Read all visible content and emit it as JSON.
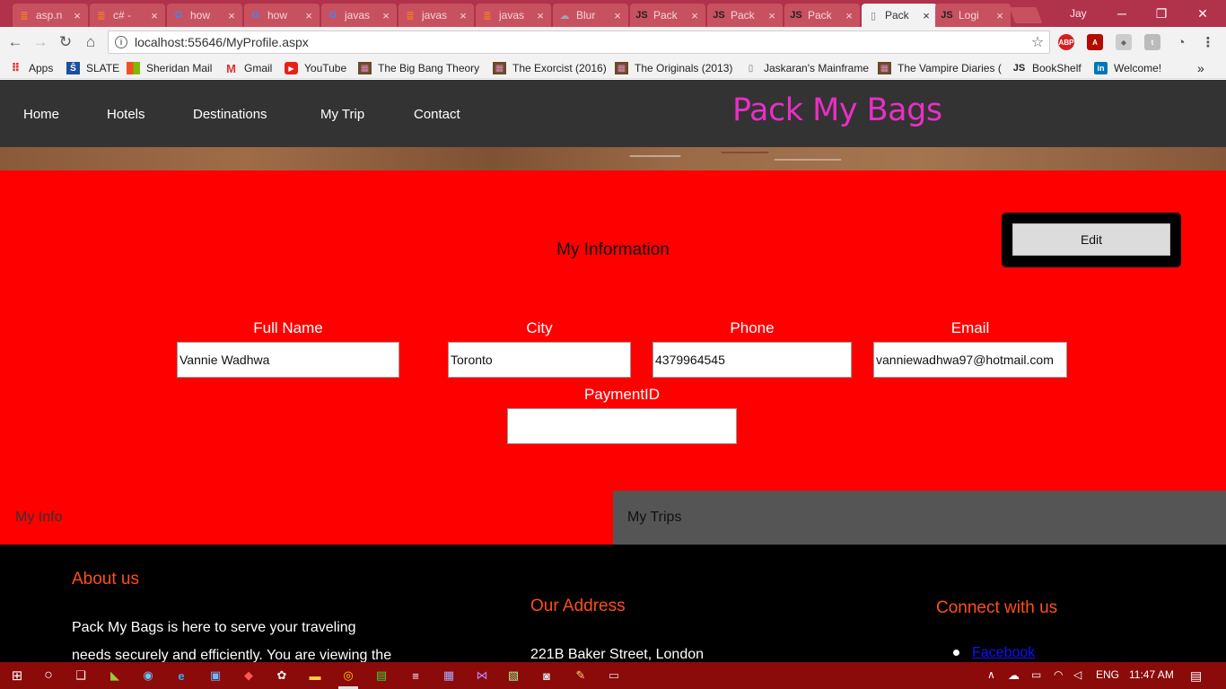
{
  "browser": {
    "tabs": [
      {
        "title": "asp.n",
        "icon": "stackoverflow-icon",
        "active": false
      },
      {
        "title": "c# -",
        "icon": "stackoverflow-icon",
        "active": false
      },
      {
        "title": "how",
        "icon": "google-icon",
        "active": false
      },
      {
        "title": "how",
        "icon": "google-icon",
        "active": false
      },
      {
        "title": "javas",
        "icon": "google-icon",
        "active": false
      },
      {
        "title": "javas",
        "icon": "stackoverflow-icon",
        "active": false
      },
      {
        "title": "javas",
        "icon": "stackoverflow-icon",
        "active": false
      },
      {
        "title": "Blur",
        "icon": "cloud-icon",
        "active": false
      },
      {
        "title": "Pack",
        "icon": "js-icon",
        "active": false
      },
      {
        "title": "Pack",
        "icon": "js-icon",
        "active": false
      },
      {
        "title": "Pack",
        "icon": "js-icon",
        "active": false
      },
      {
        "title": "Pack",
        "icon": "page-icon",
        "active": true
      },
      {
        "title": "Logi",
        "icon": "js-icon",
        "active": false
      }
    ],
    "tab_close_glyph": "×",
    "profile_name": "Jay",
    "url": "localhost:55646/MyProfile.aspx",
    "bookmarks": [
      {
        "label": "Apps",
        "icon": "apps-icon"
      },
      {
        "label": "SLATE",
        "icon": "slate-icon"
      },
      {
        "label": "Sheridan Mail",
        "icon": "microsoft-icon"
      },
      {
        "label": "Gmail",
        "icon": "gmail-icon"
      },
      {
        "label": "YouTube",
        "icon": "youtube-icon"
      },
      {
        "label": "The Big Bang Theory",
        "icon": "film-icon"
      },
      {
        "label": "The Exorcist (2016)",
        "icon": "film-icon"
      },
      {
        "label": "The Originals (2013)",
        "icon": "film-icon"
      },
      {
        "label": "Jaskaran's Mainframe",
        "icon": "page-icon"
      },
      {
        "label": "The Vampire Diaries (",
        "icon": "film-icon"
      },
      {
        "label": "BookShelf",
        "icon": "js-icon"
      },
      {
        "label": "Welcome!",
        "icon": "linkedin-icon"
      }
    ],
    "bookmarks_overflow": "»"
  },
  "site": {
    "nav": [
      "Home",
      "Hotels",
      "Destinations",
      "My Trip",
      "Contact"
    ],
    "brand": "Pack My Bags",
    "section_title": "My Information",
    "edit_label": "Edit",
    "fields": {
      "full_name": {
        "label": "Full Name",
        "value": "Vannie Wadhwa"
      },
      "city": {
        "label": "City",
        "value": "Toronto"
      },
      "phone": {
        "label": "Phone",
        "value": "4379964545"
      },
      "email": {
        "label": "Email",
        "value": "vanniewadhwa97@hotmail.com"
      },
      "payment": {
        "label": "PaymentID",
        "value": ""
      }
    },
    "tabs": {
      "my_info": "My Info",
      "my_trips": "My Trips"
    },
    "footer": {
      "about_head": "About us",
      "about_line1": "Pack My Bags is here to serve your traveling",
      "about_line2": "needs securely and efficiently. You are viewing the",
      "address_head": "Our Address",
      "address_line": "221B Baker Street, London",
      "connect_head": "Connect with us",
      "link_facebook": "Facebook"
    }
  },
  "taskbar": {
    "language": "ENG",
    "time": "11:47 AM"
  },
  "colors": {
    "tabstrip": "#b0324b",
    "site_nav": "#333333",
    "brand": "#e92fc5",
    "panel": "#ff0000",
    "footer_heading": "#ff4e1a",
    "taskbar": "#8b0a0a"
  }
}
